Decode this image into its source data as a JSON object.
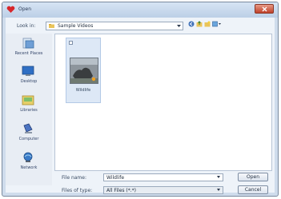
{
  "dialog": {
    "title": "Open",
    "close_icon": "close-icon",
    "app_icon": "heart-app-icon"
  },
  "look_in": {
    "label": "Look in:",
    "value": "Sample Videos",
    "nav_icons": [
      "back-arrow-icon",
      "up-folder-icon",
      "new-folder-icon",
      "view-menu-icon"
    ]
  },
  "places": [
    {
      "label": "Recent Places",
      "icon": "recent-places-icon"
    },
    {
      "label": "Desktop",
      "icon": "desktop-icon"
    },
    {
      "label": "Libraries",
      "icon": "libraries-icon"
    },
    {
      "label": "Computer",
      "icon": "computer-icon"
    },
    {
      "label": "Network",
      "icon": "network-icon"
    }
  ],
  "files": [
    {
      "name": "Wildlife",
      "icon": "video-thumbnail"
    }
  ],
  "file_name": {
    "label": "File name:",
    "value": "Wildlife"
  },
  "file_type": {
    "label": "Files of type:",
    "value": "All Files (*.*)"
  },
  "buttons": {
    "open": "Open",
    "cancel": "Cancel"
  },
  "colors": {
    "title_bar": "#c8d8ec",
    "close_button": "#c0412a",
    "selection": "#dde8f6"
  }
}
